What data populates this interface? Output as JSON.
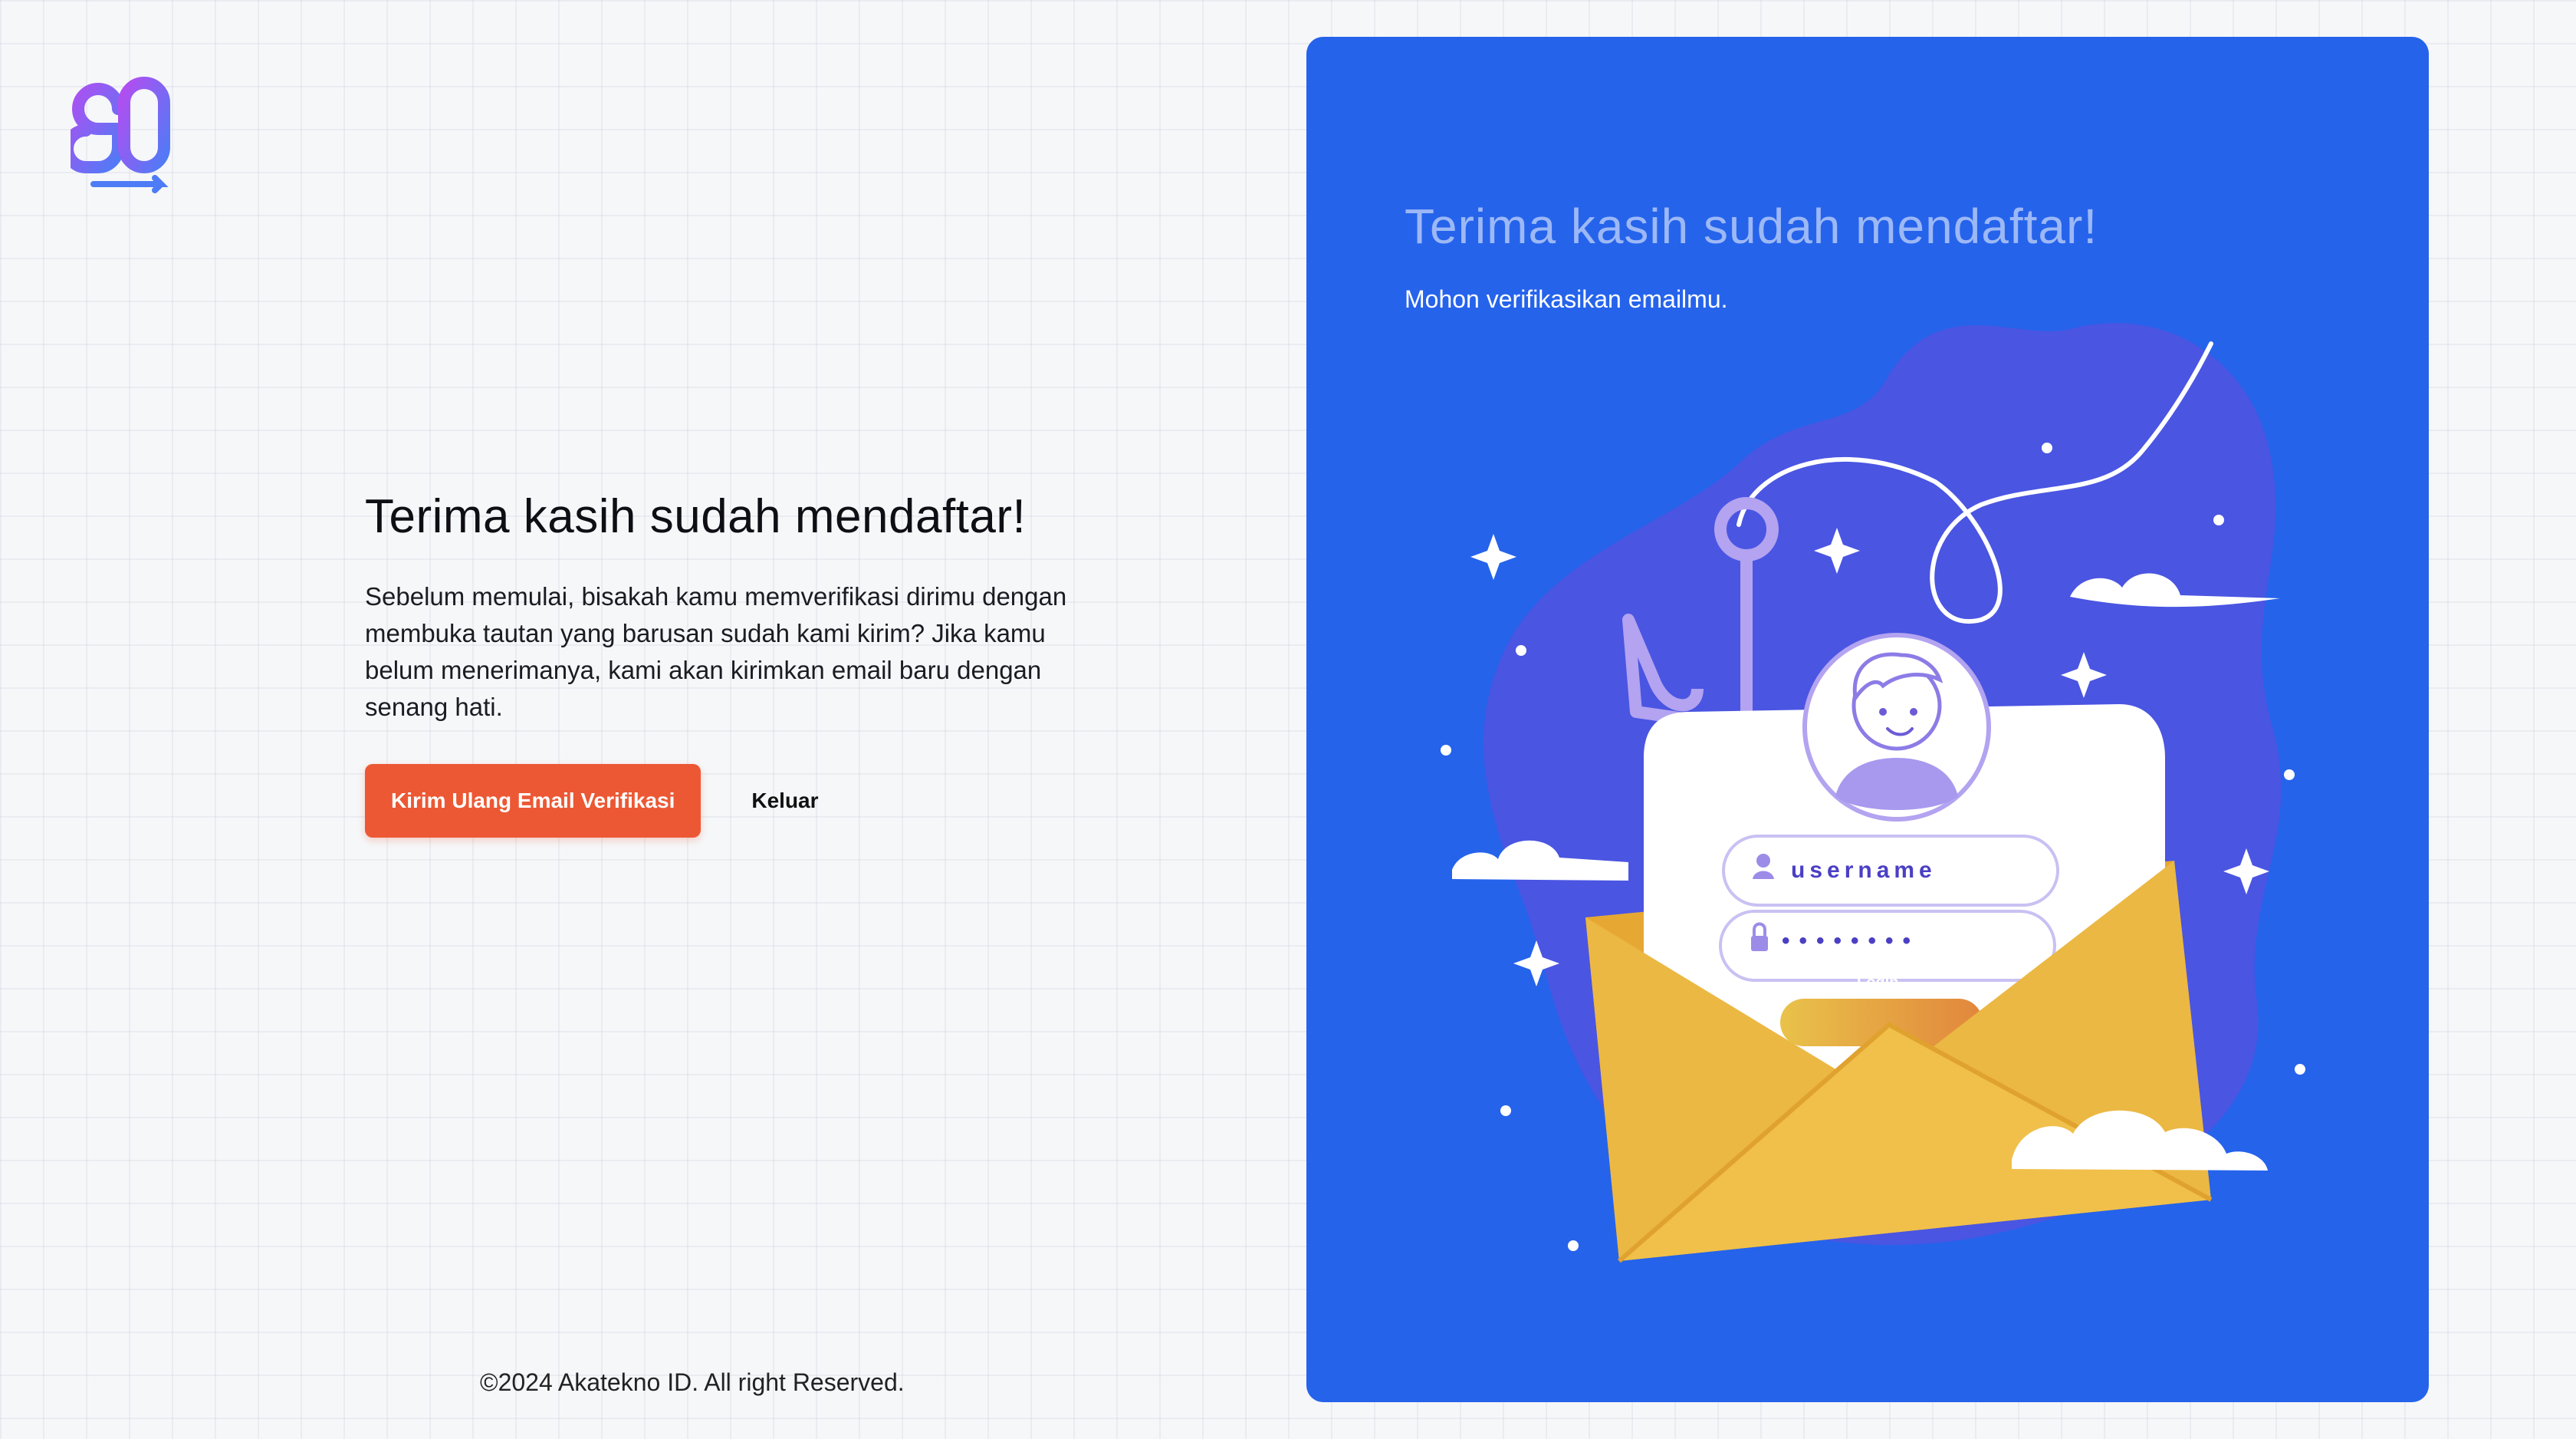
{
  "logo": {
    "icon": "go-logo-icon"
  },
  "main": {
    "title": "Terima kasih sudah mendaftar!",
    "description": "Sebelum memulai, bisakah kamu memverifikasi dirimu dengan membuka tautan yang barusan sudah kami kirim? Jika kamu belum menerimanya, kami akan kirimkan email baru dengan senang hati.",
    "resend_button": "Kirim Ulang Email Verifikasi",
    "logout_button": "Keluar"
  },
  "footer": {
    "copyright": "©2024 Akatekno ID. All right Reserved."
  },
  "panel": {
    "title": "Terima kasih sudah mendaftar!",
    "subtitle": "Mohon verifikasikan emailmu.",
    "illustration": {
      "username_text": "username",
      "password_mask": "••••••••",
      "login_label": "Login"
    }
  },
  "colors": {
    "panel_bg": "#2563eb",
    "primary_button": "#ec5834",
    "envelope": "#ebb843",
    "blob": "#4a55e2"
  }
}
